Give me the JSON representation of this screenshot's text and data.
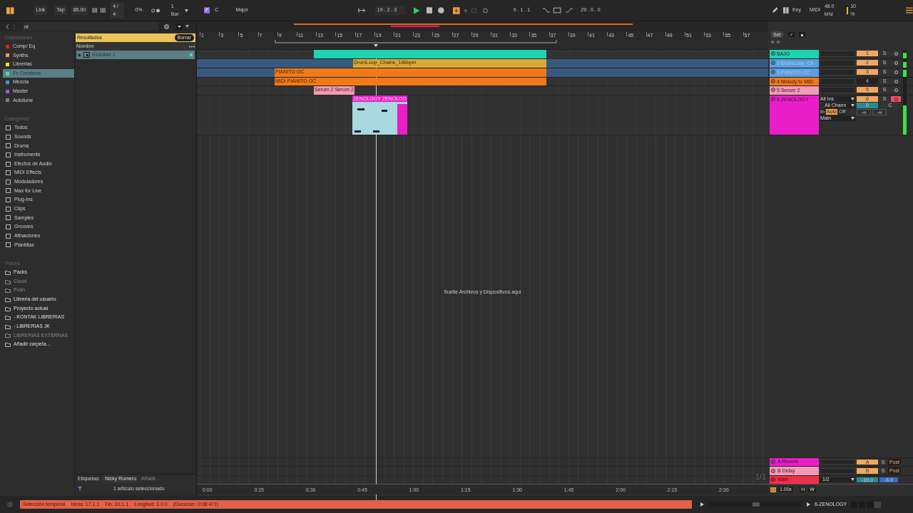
{
  "transport": {
    "link": "Link",
    "tap": "Tap",
    "tempo": "85.00",
    "signature": "4 / 4",
    "groove": "0%",
    "quantize": "1 Bar",
    "key": "C",
    "scale": "Major",
    "position": "19 . 2 . 3",
    "playing": true,
    "loop_start": "9 . 1 . 1",
    "loop_length": "29 . 0 . 0",
    "key_map": "Key",
    "midi_map": "MIDI",
    "sample_rate": "48.0 kHz",
    "cpu": "10 %"
  },
  "browser": {
    "search": "nl",
    "collections_title": "Colecciones",
    "collections": [
      {
        "label": "Comp/ Eq",
        "color": "#e0202a",
        "selected": false
      },
      {
        "label": "Synths",
        "color": "#f0a040",
        "selected": false
      },
      {
        "label": "Librerias",
        "color": "#f0e020",
        "selected": false
      },
      {
        "label": "Fx Creativos",
        "color": "#40e0a0",
        "selected": true
      },
      {
        "label": "Mezcla",
        "color": "#3a9ad9",
        "selected": false
      },
      {
        "label": "Master",
        "color": "#9a5ae0",
        "selected": false
      },
      {
        "label": "Autotune",
        "color": "#808080",
        "selected": false
      }
    ],
    "categories_title": "Categorias",
    "categories": [
      "Todos",
      "Sounds",
      "Drums",
      "Instruments",
      "Efectos de Audio",
      "MIDI Effects",
      "Moduladores",
      "Max for Live",
      "Plug-Ins",
      "Clips",
      "Samples",
      "Grooves",
      "Afinaciones",
      "Plantillas"
    ],
    "places_title": "Places",
    "places": [
      {
        "label": "Packs",
        "disabled": false
      },
      {
        "label": "Cloud",
        "disabled": true
      },
      {
        "label": "Push",
        "disabled": true
      },
      {
        "label": "Libreria del usuario",
        "disabled": false
      },
      {
        "label": "Proyecto actual",
        "disabled": false
      },
      {
        "label": "- KONTAK LIBRERIAS",
        "disabled": false
      },
      {
        "label": "- LIBRERIAS JK",
        "disabled": false
      },
      {
        "label": "LIBRERIAS EXTERNAS",
        "disabled": true
      },
      {
        "label": "Añadir carpeta...",
        "disabled": false
      }
    ],
    "results_title": "Resultados",
    "clear_button": "Borrar",
    "column": "Nombre",
    "results": [
      {
        "label": "Kickstart 2",
        "selected": true
      }
    ],
    "tags_label": "Etiquetas:",
    "tags": [
      "Nicky Romero"
    ],
    "add_tag": "Añadir...",
    "selection_info": "1 artículo seleccionado"
  },
  "arrangement": {
    "bar_numbers": [
      "1",
      "3",
      "5",
      "7",
      "9",
      "11",
      "13",
      "15",
      "17",
      "19",
      "21",
      "23",
      "25",
      "27",
      "29",
      "31",
      "33",
      "35",
      "37",
      "39",
      "41",
      "43",
      "45",
      "47",
      "49",
      "51",
      "53",
      "55",
      "57"
    ],
    "time_ticks": [
      "0:00",
      "0:15",
      "0:30",
      "0:45",
      "1:00",
      "1:15",
      "1:30",
      "1:45",
      "2:00",
      "2:15",
      "2:30"
    ],
    "drop_hint": "Suelte Archivos y Dispositivos aquí",
    "zoom_label": "1/1"
  },
  "mixer": {
    "set_button": "Set",
    "speed": "1.00x",
    "h_button": "H",
    "w_button": "W"
  },
  "tracks": [
    {
      "name": "BAJO",
      "color": "#1ed3b0",
      "selected": false,
      "number": "1",
      "solo": "S",
      "active": true,
      "armed": false,
      "level": 0.7,
      "clip": {
        "color": "#1ed3b0",
        "selected": false
      }
    },
    {
      "name": "2 DrumLoop_Ch",
      "color": "#5b9fe0",
      "selected": true,
      "number": "2",
      "solo": "S",
      "active": true,
      "armed": false,
      "level": 0.7,
      "clip": {
        "label": "DrumLoop_Chains_146bpm",
        "color": "#d9a93a",
        "selected": false
      }
    },
    {
      "name": "3 PIANITO OC",
      "color": "#5b9fe0",
      "selected": true,
      "number": "3",
      "solo": "S",
      "active": true,
      "armed": false,
      "level": 0.8,
      "clip": {
        "label": "PIANITO OC",
        "color": "#f07a1a",
        "selected": false
      }
    },
    {
      "name": "4 Melody to MID",
      "color": "#f07a1a",
      "selected": false,
      "number": "4",
      "solo": "S",
      "active": false,
      "armed": false,
      "clip": {
        "label": "MIDI PIANITO OC",
        "color": "#f07a1a",
        "selected": false
      }
    },
    {
      "name": "5 Serum 2",
      "color": "#f39ab8",
      "selected": false,
      "number": "5",
      "solo": "S",
      "active": true,
      "armed": false,
      "clip": {
        "label": "Serum 2 Serum 2",
        "color": "#f39ab8",
        "selected": false
      }
    },
    {
      "name": "6 ZENOLOGY",
      "color": "#e91ec8",
      "selected": false,
      "number": "6",
      "solo": "S",
      "active": true,
      "armed": true,
      "level": 0.75,
      "clip": {
        "label": "ZENOLOGY ZENOLOG",
        "color": "#e91ec8",
        "selected": true
      },
      "io": {
        "input": "All Ins",
        "channel": "All Chann",
        "monitor": [
          {
            "label": "In",
            "selected": false
          },
          {
            "label": "Auto",
            "selected": true
          },
          {
            "label": "Off",
            "selected": false
          }
        ],
        "output": "Main",
        "volume": "0",
        "pan": "C",
        "peaks": [
          "-∞",
          "-∞"
        ]
      }
    }
  ],
  "returns": [
    {
      "name": "A Reverb",
      "color": "#e91ec8",
      "send": "A",
      "solo": "S",
      "post": "Post"
    },
    {
      "name": "B Delay",
      "color": "#f39ab8",
      "send": "B",
      "solo": "S",
      "post": "Post"
    }
  ],
  "main": {
    "name": "Main",
    "color": "#f0304a",
    "input": "1/2",
    "volume": "-10.0",
    "pan": "-6.0"
  },
  "status": {
    "items": [
      "Selección temporal",
      "Inicio: 17.1.1",
      "Fin: 20.1.1",
      "Longitud: 3.0.0",
      "(Duración: 0:08:471)"
    ],
    "device": "6-ZENOLOGY"
  }
}
